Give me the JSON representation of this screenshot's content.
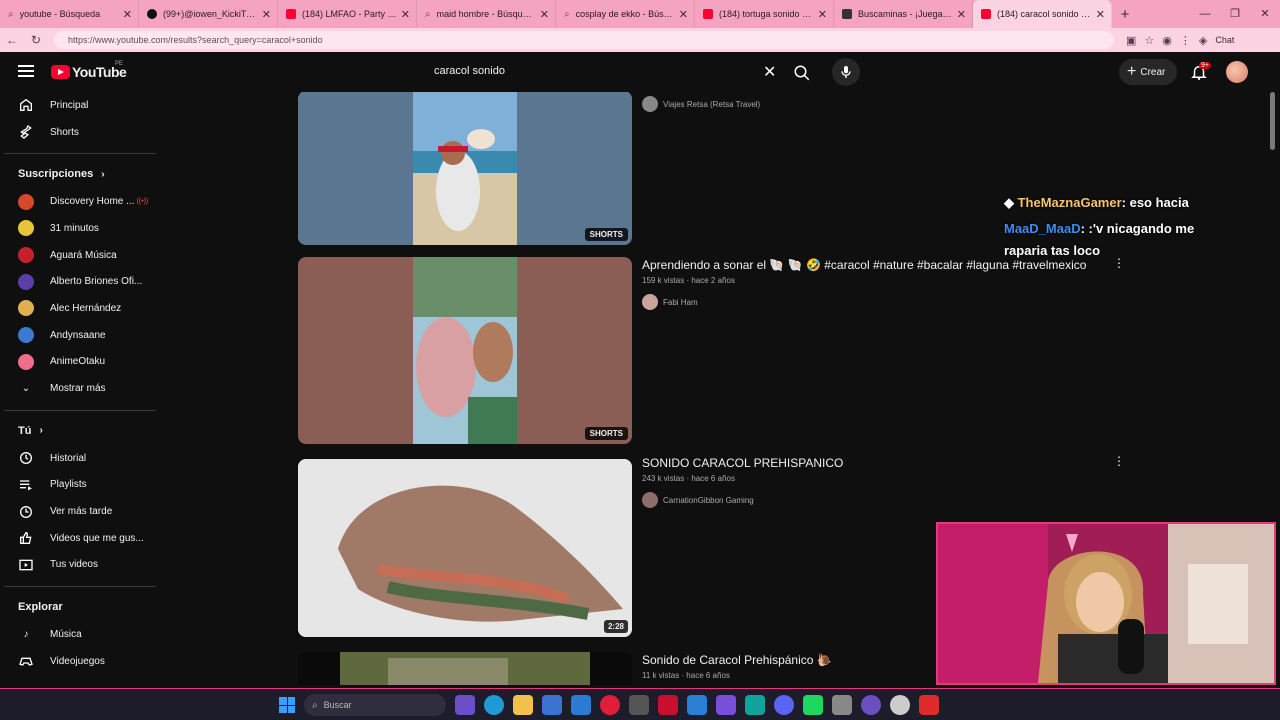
{
  "browser": {
    "tabs": [
      {
        "title": "youtube - Búsqueda",
        "icon": "search-icon"
      },
      {
        "title": "(99+)@iowen_KickiTusOwe",
        "icon": "tiktok-icon"
      },
      {
        "title": "(184) LMFAO - Party Rock A",
        "icon": "youtube-icon"
      },
      {
        "title": "maid hombre - Búsqueda",
        "icon": "search-icon"
      },
      {
        "title": "cosplay de ekko - Búsqueda",
        "icon": "search-icon"
      },
      {
        "title": "(184) tortuga sonido - YouTu",
        "icon": "youtube-icon"
      },
      {
        "title": "Buscaminas - ¡Juega ahora!",
        "icon": "game-icon"
      },
      {
        "title": "(184) caracol sonido - YouTu",
        "icon": "youtube-icon"
      }
    ],
    "url": "https://www.youtube.com/results?search_query=caracol+sonido",
    "chat_label": "Chat"
  },
  "header": {
    "logo_text": "YouTube",
    "country": "PE",
    "search_value": "caracol sonido",
    "create_label": "Crear",
    "notif_count": "9+"
  },
  "sidebar": {
    "top": [
      {
        "label": "Principal",
        "icon": "home-icon"
      },
      {
        "label": "Shorts",
        "icon": "shorts-icon"
      }
    ],
    "subs_heading": "Suscripciones",
    "subs": [
      {
        "label": "Discovery Home ...",
        "color": "#d9472b"
      },
      {
        "label": "31 minutos",
        "color": "#e8c43a"
      },
      {
        "label": "Aguará Música",
        "color": "#c8202a"
      },
      {
        "label": "Alberto Briones Ofi...",
        "color": "#5b3ea8"
      },
      {
        "label": "Alec Hernández",
        "color": "#e0b050"
      },
      {
        "label": "Andynsaane",
        "color": "#3a7ad0"
      },
      {
        "label": "AnimeOtaku",
        "color": "#f26d8a"
      }
    ],
    "show_more": "Mostrar más",
    "you_heading": "Tú",
    "you": [
      {
        "label": "Historial",
        "icon": "history-icon"
      },
      {
        "label": "Playlists",
        "icon": "playlist-icon"
      },
      {
        "label": "Ver más tarde",
        "icon": "clock-icon"
      },
      {
        "label": "Videos que me gus...",
        "icon": "thumbs-up-icon"
      },
      {
        "label": "Tus videos",
        "icon": "video-icon"
      }
    ],
    "explore_heading": "Explorar",
    "explore": [
      {
        "label": "Música",
        "icon": "music-icon"
      },
      {
        "label": "Videojuegos",
        "icon": "gamepad-icon"
      }
    ]
  },
  "results": [
    {
      "title": "",
      "meta": "",
      "channel": "Viajes Retsa (Retsa Travel)",
      "badge": "SHORTS"
    },
    {
      "title": "Aprendiendo a sonar el 🐚 🐚 🤣 #caracol #nature #bacalar #laguna #travelmexico",
      "meta": "159 k vistas · hace 2 años",
      "channel": "Fabi Ham",
      "badge": "SHORTS"
    },
    {
      "title": "SONIDO CARACOL PREHISPANICO",
      "meta": "243 k vistas · hace 6 años",
      "channel": "CarnationGibbon Gaming",
      "badge": "2:28"
    },
    {
      "title": "Sonido de Caracol Prehispánico 🐌",
      "meta": "11 k vistas · hace 6 años",
      "channel": "",
      "badge": ""
    }
  ],
  "chat": [
    {
      "user": "TheMaznaGamer",
      "message": ": eso hacia"
    },
    {
      "user": "MaaD_MaaD",
      "message": ": :'v nicagando me raparia tas loco"
    }
  ],
  "taskbar": {
    "search_placeholder": "Buscar"
  }
}
